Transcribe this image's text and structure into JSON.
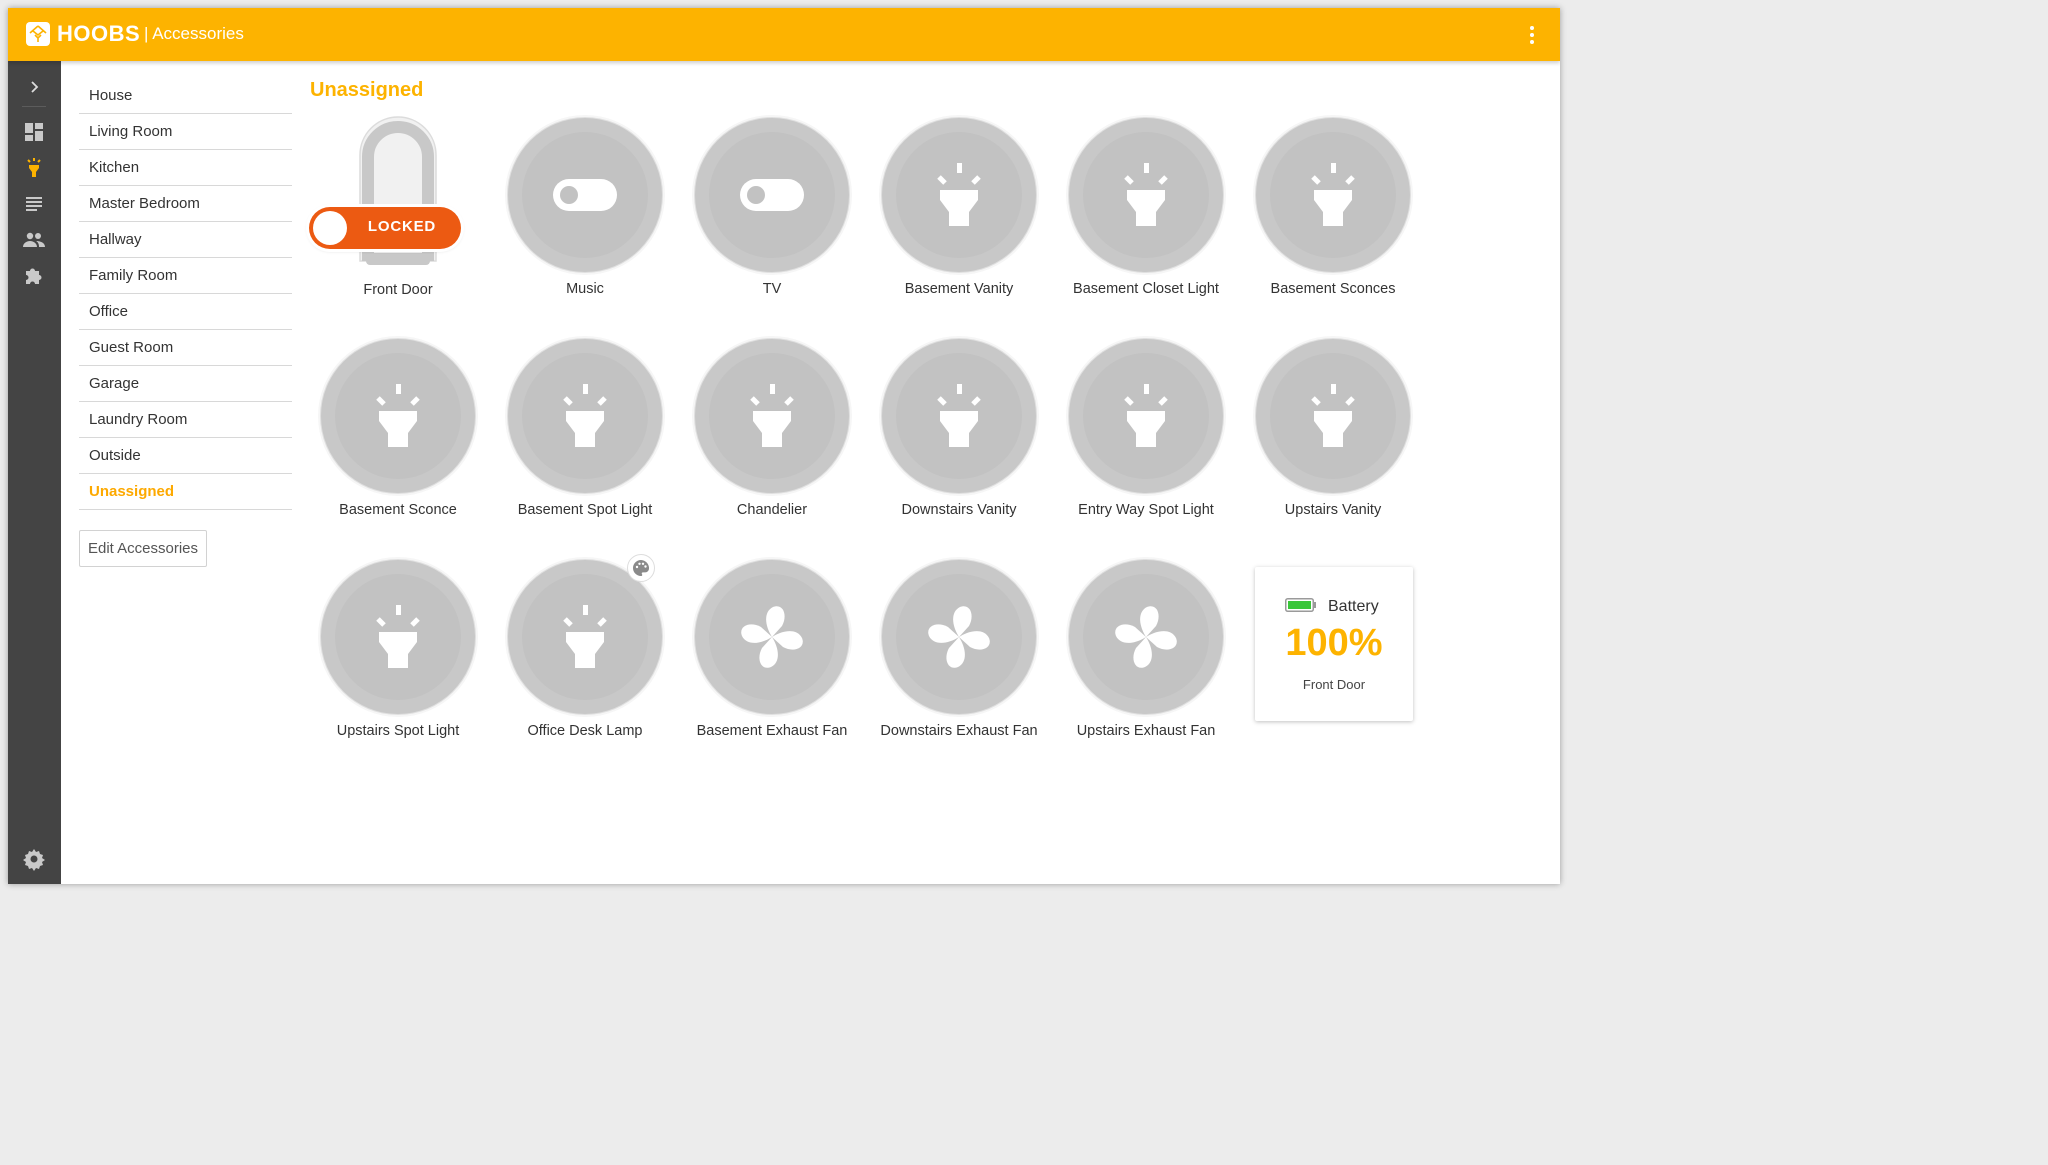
{
  "header": {
    "brand": "HOOBS",
    "section": "| Accessories",
    "menu_icon": "more-vert-icon"
  },
  "rail": {
    "items": [
      {
        "icon": "chevron-right-icon"
      },
      {
        "icon": "dashboard-icon"
      },
      {
        "icon": "lightbulb-icon",
        "active": true
      },
      {
        "icon": "log-icon"
      },
      {
        "icon": "users-icon"
      },
      {
        "icon": "puzzle-icon"
      },
      {
        "icon": "gear-icon"
      }
    ],
    "active_color": "#fdb300"
  },
  "sidebar": {
    "rooms": [
      {
        "label": "House"
      },
      {
        "label": "Living Room"
      },
      {
        "label": "Kitchen"
      },
      {
        "label": "Master Bedroom"
      },
      {
        "label": "Hallway"
      },
      {
        "label": "Family Room"
      },
      {
        "label": "Office"
      },
      {
        "label": "Guest Room"
      },
      {
        "label": "Garage"
      },
      {
        "label": "Laundry Room"
      },
      {
        "label": "Outside"
      },
      {
        "label": "Unassigned",
        "active": true
      }
    ],
    "edit_button": "Edit Accessories"
  },
  "main": {
    "title": "Unassigned",
    "accessories": [
      {
        "name": "Front Door",
        "type": "lock",
        "state": "LOCKED"
      },
      {
        "name": "Music",
        "type": "switch"
      },
      {
        "name": "TV",
        "type": "switch"
      },
      {
        "name": "Basement Vanity",
        "type": "light"
      },
      {
        "name": "Basement Closet Light",
        "type": "light"
      },
      {
        "name": "Basement Sconces",
        "type": "light"
      },
      {
        "name": "Basement Sconce",
        "type": "light"
      },
      {
        "name": "Basement Spot Light",
        "type": "light"
      },
      {
        "name": "Chandelier",
        "type": "light"
      },
      {
        "name": "Downstairs Vanity",
        "type": "light"
      },
      {
        "name": "Entry Way Spot Light",
        "type": "light"
      },
      {
        "name": "Upstairs Vanity",
        "type": "light"
      },
      {
        "name": "Upstairs Spot Light",
        "type": "light"
      },
      {
        "name": "Office Desk Lamp",
        "type": "light",
        "badge_icon": "palette-icon"
      },
      {
        "name": "Basement Exhaust Fan",
        "type": "fan"
      },
      {
        "name": "Downstairs Exhaust Fan",
        "type": "fan"
      },
      {
        "name": "Upstairs Exhaust Fan",
        "type": "fan"
      }
    ],
    "battery": {
      "title": "Battery",
      "value": "100%",
      "device": "Front Door",
      "level_fraction": 1.0,
      "fill_color": "#39c639"
    },
    "colors": {
      "accent": "#fdb300",
      "lock_on": "#ec5a12",
      "tile_grey": "#c8c8c8"
    }
  }
}
